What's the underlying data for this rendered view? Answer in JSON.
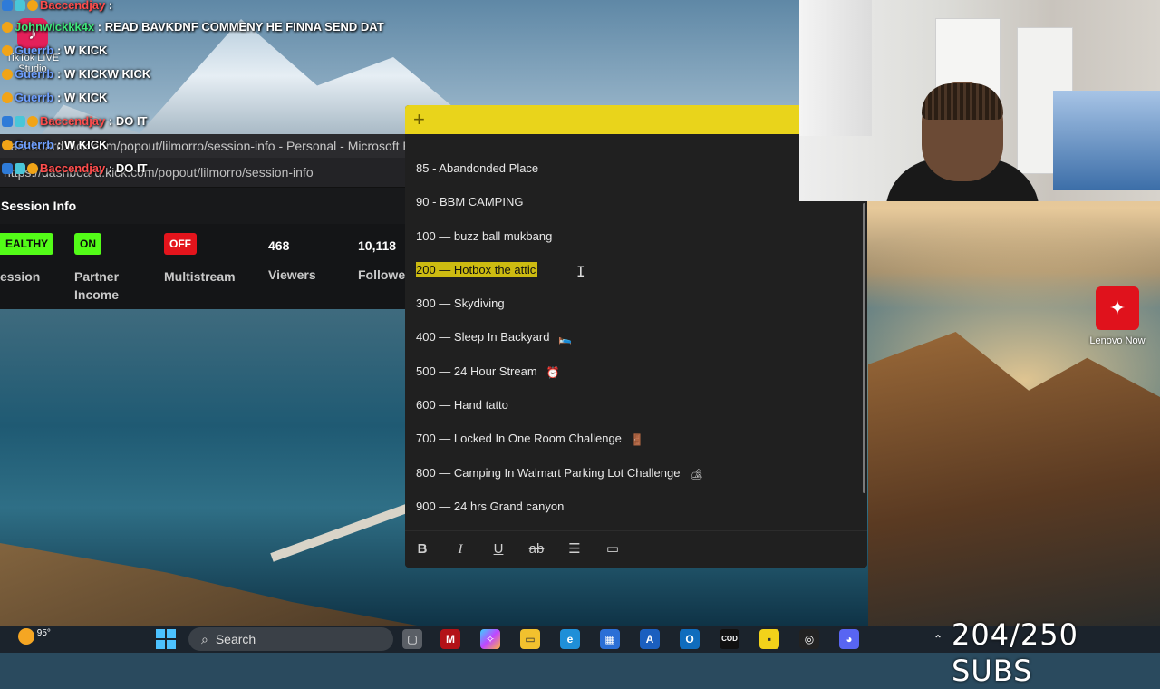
{
  "chat": [
    {
      "user": "Baccendjay",
      "sep": " :",
      "msg": "",
      "color": "red"
    },
    {
      "user": "Johnwickkk4x",
      "sep": " :",
      "msg": " READ BAVKDNF COMMENY HE FINNA SEND DAT",
      "color": "green"
    },
    {
      "user": "Guerrb",
      "sep": " :",
      "msg": " W KICK",
      "color": "blue"
    },
    {
      "user": "Guerrb",
      "sep": " :",
      "msg": " W KICKW KICK",
      "color": "blue"
    },
    {
      "user": "Guerrb",
      "sep": " :",
      "msg": " W KICK",
      "color": "blue"
    },
    {
      "user": "Baccendjay",
      "sep": " :",
      "msg": " DO IT",
      "color": "red"
    },
    {
      "user": "Guerrb",
      "sep": " :",
      "msg": " W KICK",
      "color": "blue"
    },
    {
      "user": "Baccendjay",
      "sep": " :",
      "msg": " DO IT",
      "color": "red"
    }
  ],
  "tiktok": {
    "line1": "TikTok LIVE",
    "line2": "Studio"
  },
  "browser": {
    "title": "dashboard.kick.com/popout/lilmorro/session-info - Personal - Microsoft E",
    "url": "https://dashboard.kick.com/popout/lilmorro/session-info",
    "section_title": "Session Info",
    "stats": {
      "health_pill": "EALTHY",
      "health_label": "ession",
      "partner_pill": "ON",
      "partner_label_1": "Partner",
      "partner_label_2": "Income",
      "multistream_pill": "OFF",
      "multistream_label": "Multistream",
      "viewers_value": "468",
      "viewers_label": "Viewers",
      "followers_value": "10,118",
      "followers_label": "Followe"
    }
  },
  "sticky": {
    "header_color": "#e9d41b",
    "lines": [
      {
        "text": "85 -  Abandonded Place",
        "emoji": ""
      },
      {
        "text": "90 - BBM CAMPING",
        "emoji": ""
      },
      {
        "text": "100 — buzz ball mukbang",
        "emoji": ""
      },
      {
        "text": "200 — Hotbox the attic ",
        "emoji": "",
        "highlight": true
      },
      {
        "text": "300 — Skydiving",
        "emoji": ""
      },
      {
        "text": "400 — Sleep In Backyard",
        "emoji": "🛌"
      },
      {
        "text": "500 — 24 Hour Stream",
        "emoji": "⏰"
      },
      {
        "text": "600 — Hand tatto",
        "emoji": ""
      },
      {
        "text": "700 — Locked In One Room Challenge",
        "emoji": "🚪"
      },
      {
        "text": "800 — Camping In Walmart Parking Lot Challenge",
        "emoji": "🏕"
      },
      {
        "text": "900 — 24 hrs Grand canyon",
        "emoji": ""
      }
    ],
    "toolbar": {
      "bold": "B",
      "italic": "I",
      "underline": "U",
      "strike": "ab",
      "list": "☰",
      "image": "▭"
    }
  },
  "desktop": {
    "lenovo_label": "Lenovo Now"
  },
  "taskbar": {
    "weather_temp": "95°",
    "search_label": "Search"
  },
  "overlay": {
    "subs": "204/250 SUBS"
  }
}
